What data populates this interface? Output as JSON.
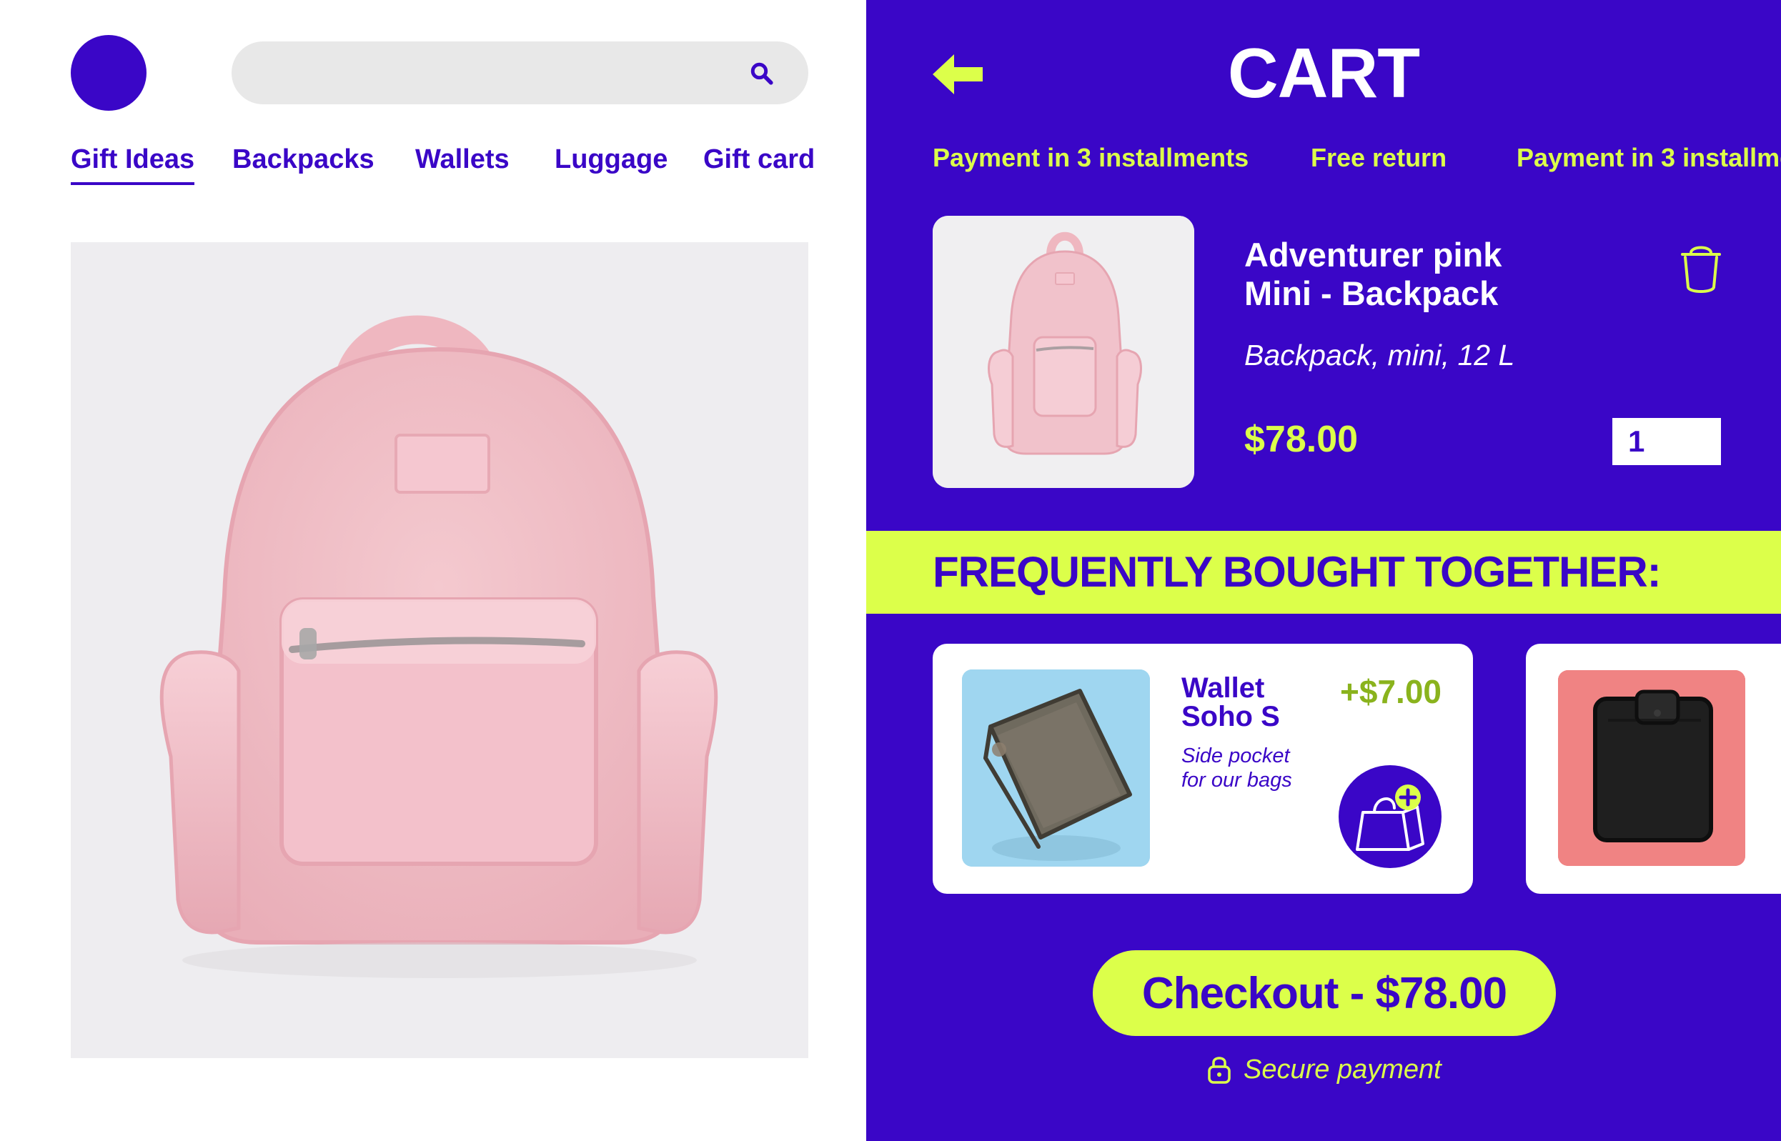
{
  "left": {
    "nav": [
      "Gift Ideas",
      "Backpacks",
      "Wallets",
      "Luggage",
      "Gift card"
    ],
    "active_nav": "Gift Ideas"
  },
  "cart": {
    "title": "CART",
    "perks": [
      "Payment in 3 installments",
      "Free return",
      "Payment in 3 installme"
    ],
    "item": {
      "name_line1": "Adventurer pink",
      "name_line2": "Mini - Backpack",
      "description": "Backpack, mini, 12 L",
      "price": "$78.00",
      "quantity": "1"
    },
    "section_title": "FREQUENTLY BOUGHT TOGETHER:",
    "recommendations": [
      {
        "name_line1": "Wallet",
        "name_line2": "Soho S",
        "price": "+$7.00",
        "desc_line1": "Side pocket",
        "desc_line2": "for our bags"
      }
    ],
    "checkout_label": "Checkout - $78.00",
    "secure_label": "Secure payment"
  },
  "colors": {
    "brand_blue": "#3a06c7",
    "accent_lime": "#dcff4a",
    "search_bg": "#e8e8e8"
  },
  "icons": [
    "search-icon",
    "back-arrow-icon",
    "trash-icon",
    "add-to-bag-icon",
    "lock-icon"
  ]
}
